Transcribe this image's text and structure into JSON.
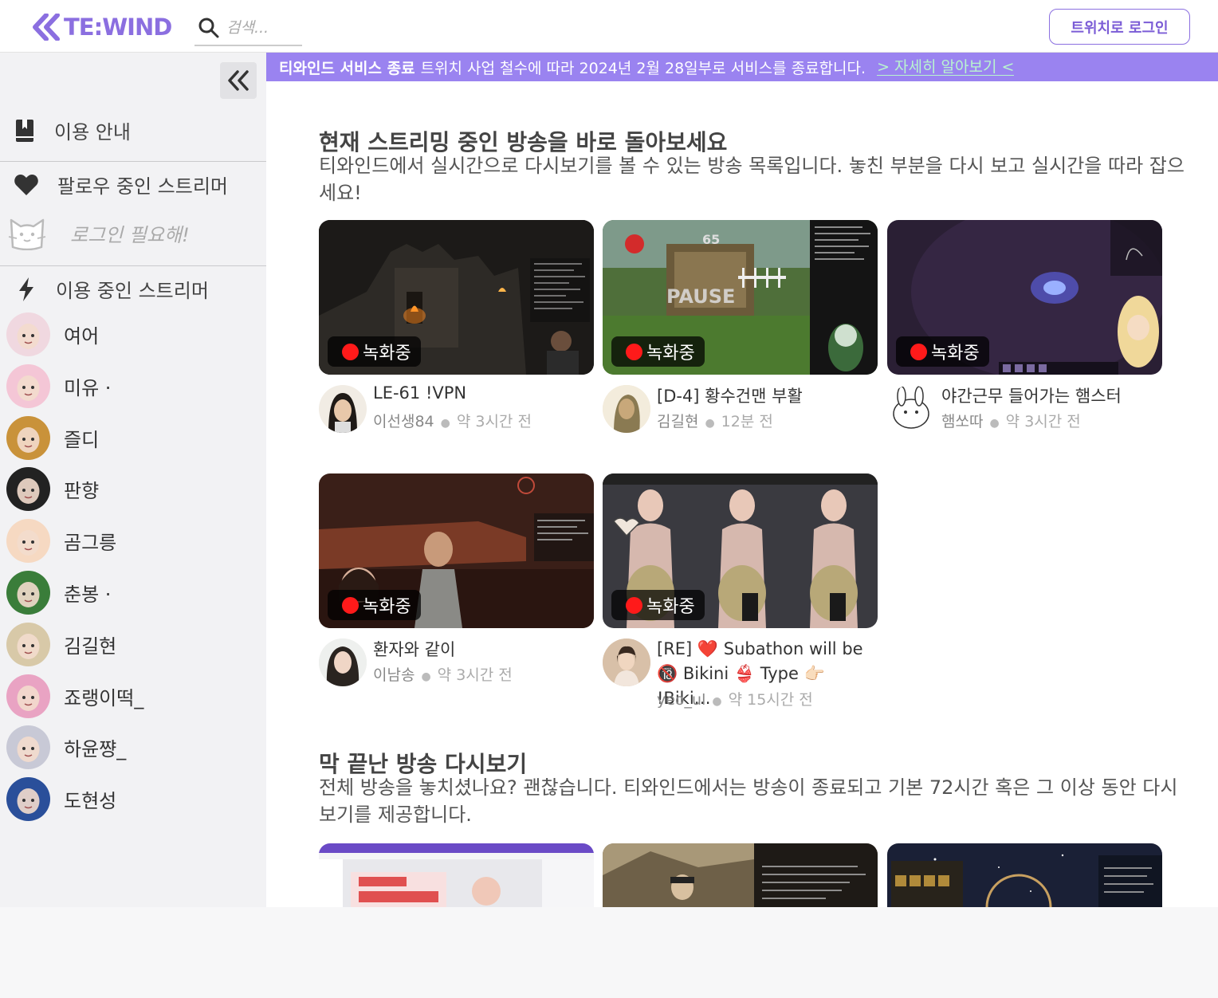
{
  "header": {
    "logo_text": "TE:WIND",
    "search_placeholder": "검색...",
    "login_label": "트위치로 로그인"
  },
  "banner": {
    "title": "티와인드 서비스 종료",
    "message": "트위치 사업 철수에 따라 2024년 2월 28일부로 서비스를 종료합니다.",
    "link": "> 자세히 알아보기 <"
  },
  "sidebar": {
    "guide_label": "이용 안내",
    "following_label": "팔로우 중인 스트리머",
    "login_needed": "로그인 필요해!",
    "active_label": "이용 중인 스트리머",
    "streamers": [
      {
        "name": "여어",
        "color": "#f0d8e0"
      },
      {
        "name": "미유 ·",
        "color": "#f4c6d6"
      },
      {
        "name": "즐디",
        "color": "#c9923a"
      },
      {
        "name": "판향",
        "color": "#222222"
      },
      {
        "name": "곰그릉",
        "color": "#f6d9c2"
      },
      {
        "name": "춘봉 ·",
        "color": "#3a7d3a"
      },
      {
        "name": "김길현",
        "color": "#d8c9a8"
      },
      {
        "name": "죠랭이떡_",
        "color": "#e9a3c3"
      },
      {
        "name": "하윤쨩_",
        "color": "#c8c9d6"
      },
      {
        "name": "도현성",
        "color": "#2a4f9a"
      }
    ]
  },
  "live_section": {
    "title": "현재 스트리밍 중인 방송을 바로 돌아보세요",
    "description": "티와인드에서 실시간으로 다시보기를 볼 수 있는 방송 목록입니다. 놓친 부분을 다시 보고 실시간을 따라 잡으세요!",
    "badge": "녹화중",
    "streams": [
      {
        "title": "LE-61 !VPN",
        "streamer": "이선생84",
        "time": "약 3시간 전"
      },
      {
        "title": "[D-4] 황수건맨 부활",
        "streamer": "김길현",
        "time": "12분 전"
      },
      {
        "title": "야간근무 들어가는 햄스터",
        "streamer": "햄쏘따",
        "time": "약 3시간 전"
      },
      {
        "title": "환자와 같이",
        "streamer": "이남송",
        "time": "약 3시간 전"
      },
      {
        "title": "[RE] ❤️ Subathon will be 🔞 Bikini 👙 Type 👉🏻 !Biki…",
        "streamer": "yeo_ul",
        "time": "약 15시간 전"
      }
    ]
  },
  "ended_section": {
    "title": "막 끝난 방송 다시보기",
    "description": "전체 방송을 놓치셨나요? 괜찮습니다. 티와인드에서는 방송이 종료되고 기본 72시간 혹은 그 이상 동안 다시보기를 제공합니다."
  },
  "colors": {
    "accent": "#8b6fe0",
    "banner": "#9a83f0",
    "recording_dot": "#ff1a1a"
  }
}
